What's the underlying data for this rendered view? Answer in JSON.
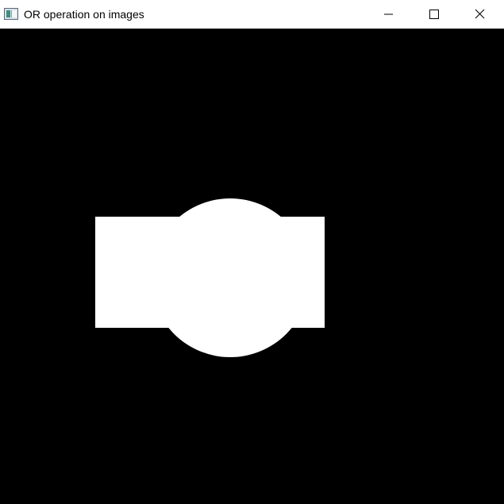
{
  "window": {
    "title": "OR operation on images",
    "app_icon": "opencv-window-icon",
    "controls": {
      "minimize_icon": "minimize-icon",
      "maximize_icon": "maximize-icon",
      "close_icon": "close-icon"
    }
  },
  "image": {
    "background_color": "#000000",
    "foreground_color": "#ffffff",
    "shapes": [
      "rectangle",
      "circle"
    ]
  }
}
